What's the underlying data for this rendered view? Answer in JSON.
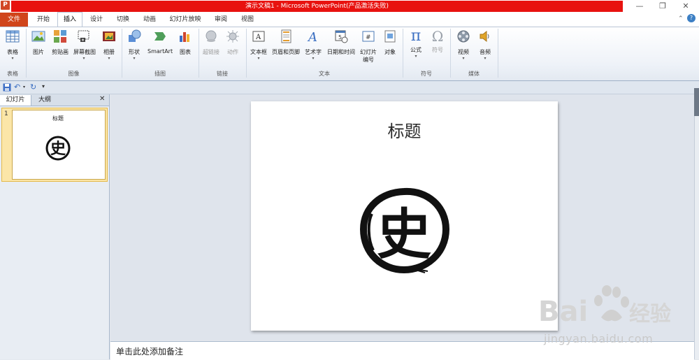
{
  "window": {
    "app_icon": "P",
    "title": "演示文稿1 - Microsoft PowerPoint(产品激活失败)",
    "controls": {
      "minimize": "—",
      "restore": "❐",
      "close": "✕"
    }
  },
  "tabs": {
    "file": "文件",
    "items": [
      "开始",
      "插入",
      "设计",
      "切换",
      "动画",
      "幻灯片放映",
      "审阅",
      "视图"
    ],
    "active": "插入"
  },
  "ribbon": {
    "buttons": {
      "table": "表格",
      "picture": "图片",
      "clipart": "剪贴画",
      "screenshot": "屏幕截图",
      "album": "相册",
      "shapes": "形状",
      "smartart": "SmartArt",
      "chart": "图表",
      "hyperlink": "超链接",
      "action": "动作",
      "textbox": "文本框",
      "header_footer": "页眉和页脚",
      "wordart": "艺术字",
      "datetime": "日期和时间",
      "slide_number_1": "幻灯片",
      "slide_number_2": "编号",
      "object": "对象",
      "equation": "公式",
      "symbol": "符号",
      "video": "视频",
      "audio": "音频"
    },
    "groups": {
      "tables": "表格",
      "images": "图像",
      "illustrations": "插图",
      "links": "链接",
      "text": "文本",
      "symbols": "符号",
      "media": "媒体"
    },
    "symbol_glyphs": {
      "pi": "π",
      "omega": "Ω"
    }
  },
  "left_pane": {
    "tab_slides": "幻灯片",
    "tab_outline": "大纲",
    "slide_number": "1",
    "thumb_title": "标题",
    "close": "✕"
  },
  "slide": {
    "title": "标题",
    "logo_char": "史"
  },
  "notes": {
    "placeholder": "单击此处添加备注"
  },
  "watermark": {
    "brand": "Bai",
    "brand2": "经验",
    "url": "jingyan.baidu.com"
  },
  "colors": {
    "title_red": "#e8120f",
    "file_tab": "#d0451b",
    "thumb_highlight": "#fbe6a8"
  }
}
